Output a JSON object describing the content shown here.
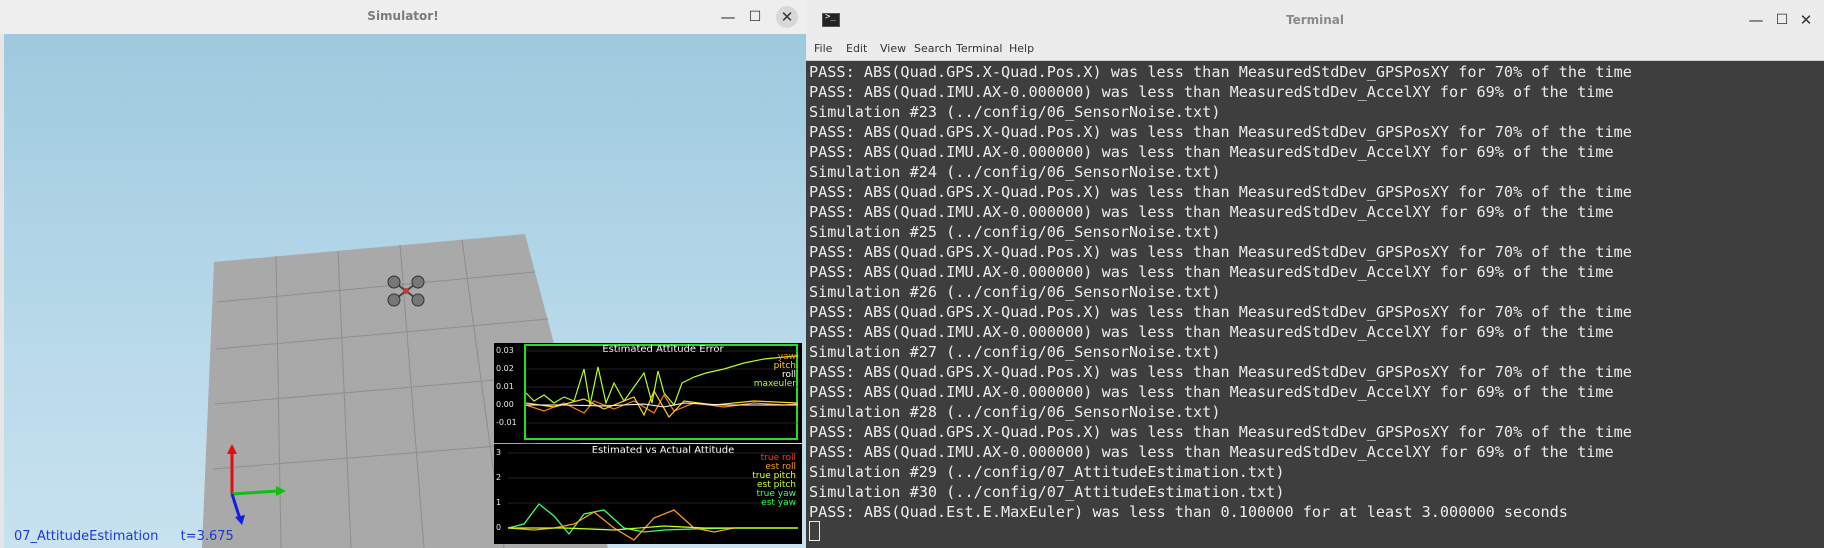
{
  "simulator": {
    "title": "Simulator!",
    "buttons": {
      "minimize": "—",
      "maximize": "☐",
      "close": "✕"
    },
    "scenario_label": "07_AttitudeEstimation",
    "time_label": "t=3.675",
    "error_plot": {
      "title": "Estimated Attitude Error",
      "yticks": [
        "0.03",
        "0.02",
        "0.01",
        "0.00",
        "-0.01"
      ],
      "legend": [
        {
          "label": "yaw",
          "color": "#ff7f1e"
        },
        {
          "label": "pitch",
          "color": "#ffd21e"
        },
        {
          "label": "roll",
          "color": "#ffffff"
        },
        {
          "label": "maxeuler",
          "color": "#b6ff1e"
        }
      ]
    },
    "attitude_plot": {
      "title": "Estimated vs Actual Attitude",
      "yticks": [
        "3",
        "2",
        "1",
        "0"
      ],
      "legend": [
        {
          "label": "true roll",
          "color": "#ff3b1e"
        },
        {
          "label": "est roll",
          "color": "#ff9a1e"
        },
        {
          "label": "true pitch",
          "color": "#e9ff1e"
        },
        {
          "label": "est pitch",
          "color": "#c8ff1e"
        },
        {
          "label": "true yaw",
          "color": "#3bff6e"
        },
        {
          "label": "est yaw",
          "color": "#1eff3b"
        }
      ]
    }
  },
  "terminal": {
    "title": "Terminal",
    "menu": [
      "File",
      "Edit",
      "View",
      "Search",
      "Terminal",
      "Help"
    ],
    "lines": [
      "PASS: ABS(Quad.GPS.X-Quad.Pos.X) was less than MeasuredStdDev_GPSPosXY for 70% of the time",
      "PASS: ABS(Quad.IMU.AX-0.000000) was less than MeasuredStdDev_AccelXY for 69% of the time",
      "Simulation #23 (../config/06_SensorNoise.txt)",
      "PASS: ABS(Quad.GPS.X-Quad.Pos.X) was less than MeasuredStdDev_GPSPosXY for 70% of the time",
      "PASS: ABS(Quad.IMU.AX-0.000000) was less than MeasuredStdDev_AccelXY for 69% of the time",
      "Simulation #24 (../config/06_SensorNoise.txt)",
      "PASS: ABS(Quad.GPS.X-Quad.Pos.X) was less than MeasuredStdDev_GPSPosXY for 70% of the time",
      "PASS: ABS(Quad.IMU.AX-0.000000) was less than MeasuredStdDev_AccelXY for 69% of the time",
      "Simulation #25 (../config/06_SensorNoise.txt)",
      "PASS: ABS(Quad.GPS.X-Quad.Pos.X) was less than MeasuredStdDev_GPSPosXY for 70% of the time",
      "PASS: ABS(Quad.IMU.AX-0.000000) was less than MeasuredStdDev_AccelXY for 69% of the time",
      "Simulation #26 (../config/06_SensorNoise.txt)",
      "PASS: ABS(Quad.GPS.X-Quad.Pos.X) was less than MeasuredStdDev_GPSPosXY for 70% of the time",
      "PASS: ABS(Quad.IMU.AX-0.000000) was less than MeasuredStdDev_AccelXY for 69% of the time",
      "Simulation #27 (../config/06_SensorNoise.txt)",
      "PASS: ABS(Quad.GPS.X-Quad.Pos.X) was less than MeasuredStdDev_GPSPosXY for 70% of the time",
      "PASS: ABS(Quad.IMU.AX-0.000000) was less than MeasuredStdDev_AccelXY for 69% of the time",
      "Simulation #28 (../config/06_SensorNoise.txt)",
      "PASS: ABS(Quad.GPS.X-Quad.Pos.X) was less than MeasuredStdDev_GPSPosXY for 70% of the time",
      "PASS: ABS(Quad.IMU.AX-0.000000) was less than MeasuredStdDev_AccelXY for 69% of the time",
      "Simulation #29 (../config/07_AttitudeEstimation.txt)",
      "Simulation #30 (../config/07_AttitudeEstimation.txt)",
      "PASS: ABS(Quad.Est.E.MaxEuler) was less than 0.100000 for at least 3.000000 seconds"
    ]
  },
  "colors": {
    "terminal_bg": "#3e3e3e",
    "terminal_text": "#ececec",
    "sky": "#b2d6e7",
    "floor": "#a8a8a8",
    "plot_frame": "#22dd22",
    "label_blue": "#1b39d8"
  }
}
